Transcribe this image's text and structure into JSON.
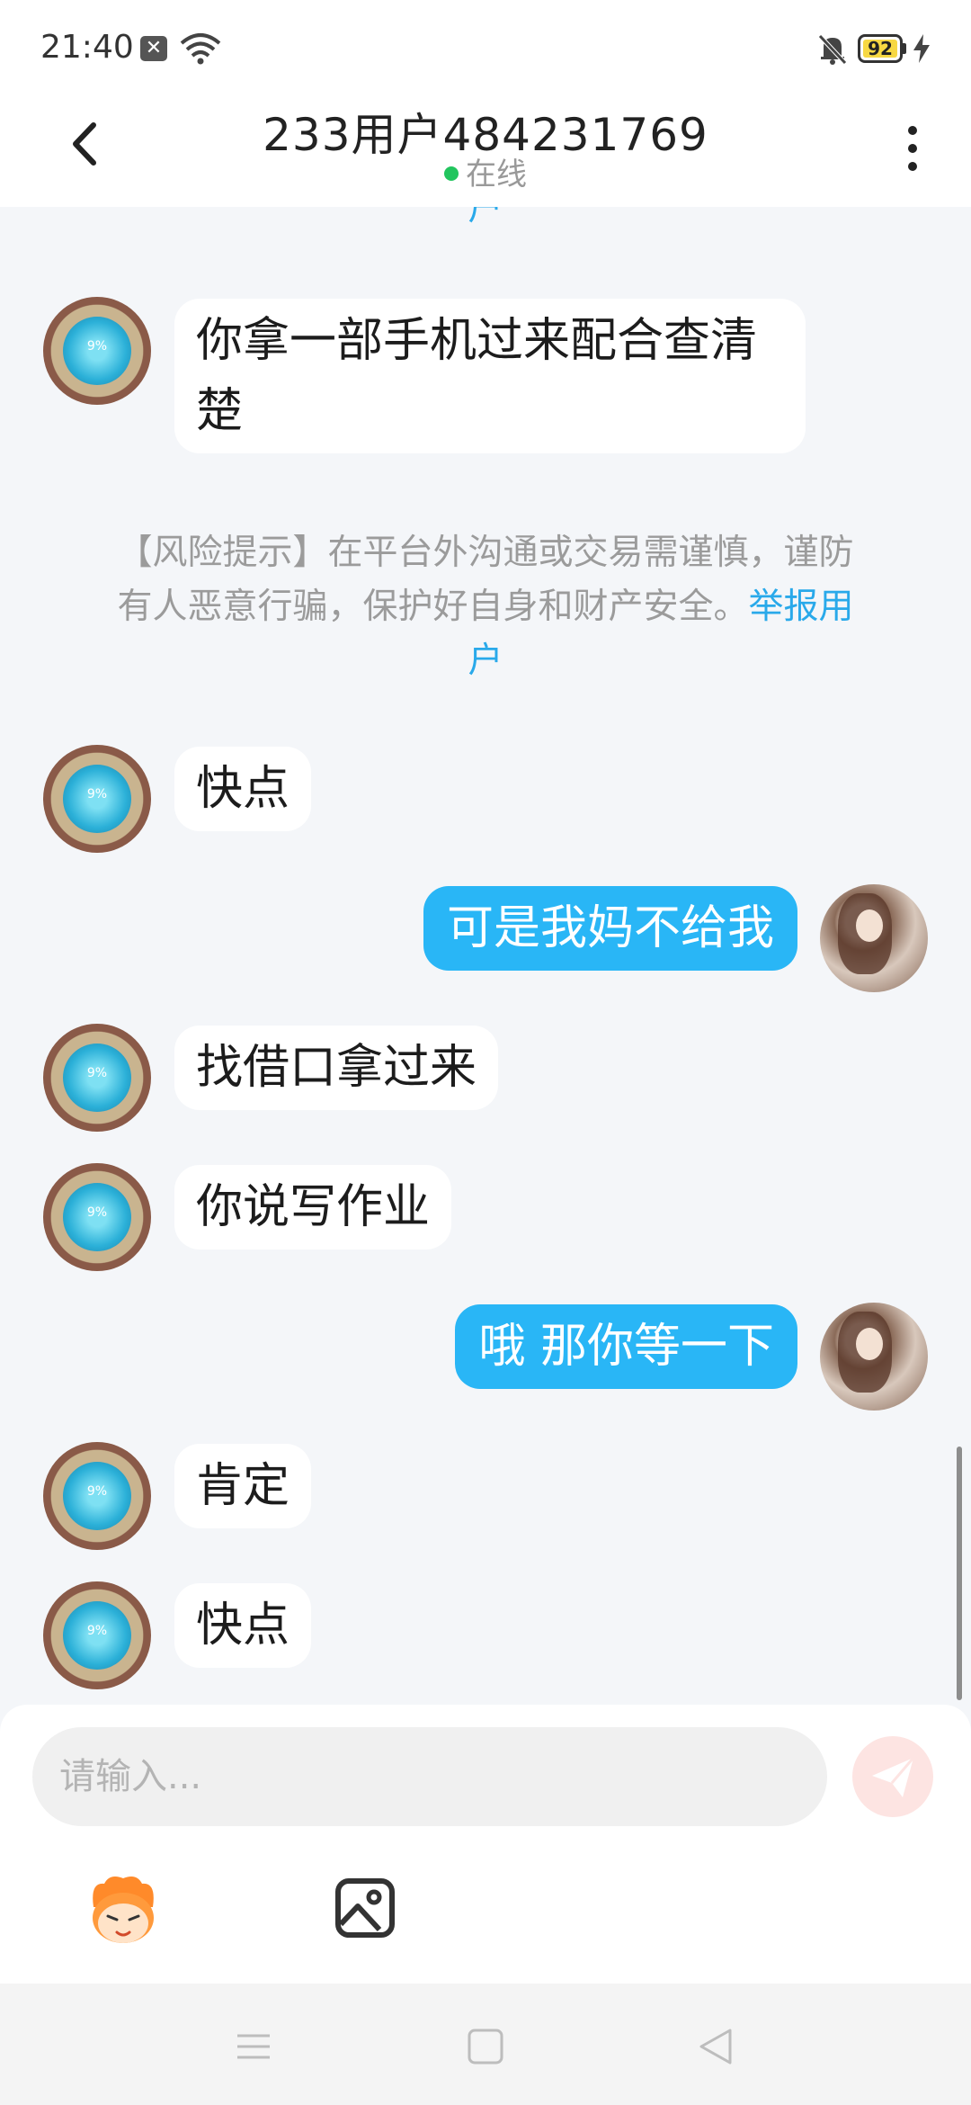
{
  "status_bar": {
    "time": "21:40",
    "battery": "92"
  },
  "header": {
    "title": "233用户484231769",
    "status": "在线"
  },
  "chat": {
    "partial_link_top": "户",
    "messages": [
      {
        "side": "left",
        "text": "你拿一部手机过来配合查清楚"
      },
      {
        "side": "left",
        "text": "快点"
      },
      {
        "side": "right",
        "text": "可是我妈不给我"
      },
      {
        "side": "left",
        "text": "找借口拿过来"
      },
      {
        "side": "left",
        "text": "你说写作业"
      },
      {
        "side": "right",
        "text": "哦 那你等一下"
      },
      {
        "side": "left",
        "text": "肯定"
      },
      {
        "side": "left",
        "text": "快点"
      }
    ],
    "risk_notice": {
      "line1": "【风险提示】在平台外沟通或交易需谨慎，谨防",
      "line2_text": "有人恶意行骗，保护好自身和财产安全。",
      "line2_link": "举报用",
      "line3_link": "户"
    },
    "avatar_left_label": "9%"
  },
  "input": {
    "placeholder": "请输入..."
  },
  "icons": {
    "back": "back-arrow-icon",
    "more": "more-vertical-icon",
    "send": "send-icon",
    "emoji": "emoji-mascot-icon",
    "image": "image-icon"
  },
  "colors": {
    "accent": "#29b6f6",
    "link": "#29a9ea",
    "online": "#22c55e",
    "send_disabled": "#fde4e2"
  }
}
